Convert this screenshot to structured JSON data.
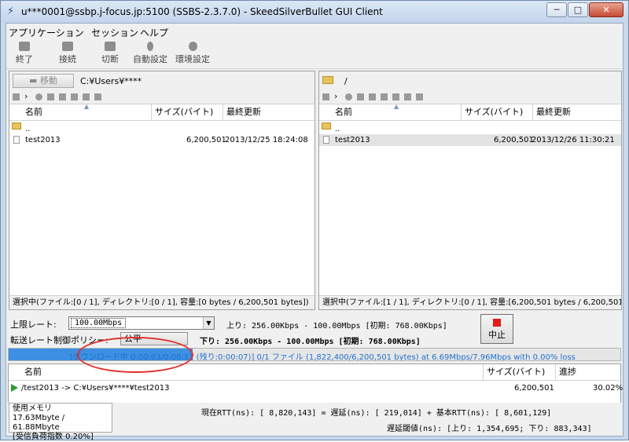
{
  "window": {
    "title": "u***0001@ssbp.j-focus.jp:5100 (SSBS-2.3.7.0) - SkeedSilverBullet GUI Client",
    "btn_min": "─",
    "btn_max": "□",
    "btn_close": "✕"
  },
  "menu": [
    "アプリケーション",
    "セッション",
    "ヘルプ"
  ],
  "toolbar": [
    {
      "label": "終了",
      "icon": "exit-icon"
    },
    {
      "label": "接続",
      "icon": "connect-icon"
    },
    {
      "label": "切断",
      "icon": "disconnect-icon"
    },
    {
      "label": "自動設定",
      "icon": "auto-setting-icon"
    },
    {
      "label": "環境設定",
      "icon": "environment-setting-icon"
    }
  ],
  "local": {
    "move_label": "移動",
    "path": "C:¥Users¥****",
    "columns": [
      "名前",
      "サイズ(バイト)",
      "最終更新"
    ],
    "rows": [
      {
        "name": "..",
        "size": "",
        "modified": ""
      },
      {
        "name": "test2013",
        "size": "6,200,501",
        "modified": "2013/12/25 18:24:08"
      }
    ],
    "status": "選択中(ファイル:[0 / 1], ディレクトリ:[0 / 1], 容量:[0 bytes / 6,200,501  bytes])"
  },
  "remote": {
    "path": "/",
    "columns": [
      "名前",
      "サイズ(バイト)",
      "最終更新"
    ],
    "rows": [
      {
        "name": "..",
        "size": "",
        "modified": ""
      },
      {
        "name": "test2013",
        "size": "6,200,501",
        "modified": "2013/12/26 11:30:21"
      }
    ],
    "status": "選択中(ファイル:[1 / 1], ディレクトリ:[0 / 1], 容量:[6,200,501  bytes / 6,200,501  bytes"
  },
  "controls": {
    "limit_label": "上限レート:",
    "limit_value": "100.00Mbps",
    "up_text": "上り: 256.00Kbps - 100.00Mbps [初期: 768.00Kbps]",
    "policy_label": "転送レート制御ポリシー:",
    "policy_value": "公平",
    "down_text": "下り: 256.00Kbps - 100.00Mbps [初期: 768.00Kbps]",
    "stop_label": "中止"
  },
  "progress": {
    "fraction": 0.3002,
    "text": "[ダウンロード中 0:00:03/0:00:11 (残り:0:00:07)] 0/1 ファイル (1,822,400/6,200,501  bytes) at 6.69Mbps/7.96Mbps with 0.00% loss"
  },
  "transfers": {
    "columns": [
      "名前",
      "サイズ(バイト)",
      "進捗"
    ],
    "rows": [
      {
        "name": "/test2013 -> C:¥Users¥****¥test2013",
        "size": "6,200,501",
        "progress": "30.02%"
      }
    ]
  },
  "footer": {
    "mem_label": "使用メモリ",
    "mem_value": "17.63Mbyte / 61.88Mbyte",
    "load_label": "[受信負荷指数 0.20%]",
    "rtt_text": "現在RTT(ns): [    8,820,143] = 遅延(ns): [      219,014] + 基本RTT(ns): [    8,601,129]",
    "delay_text": "遅延閾値(ns): [上り: 1,354,695; 下り: 883,343]"
  },
  "colors": {
    "progress_fill": "#3c8fe2",
    "annotation": "#e0302a"
  }
}
